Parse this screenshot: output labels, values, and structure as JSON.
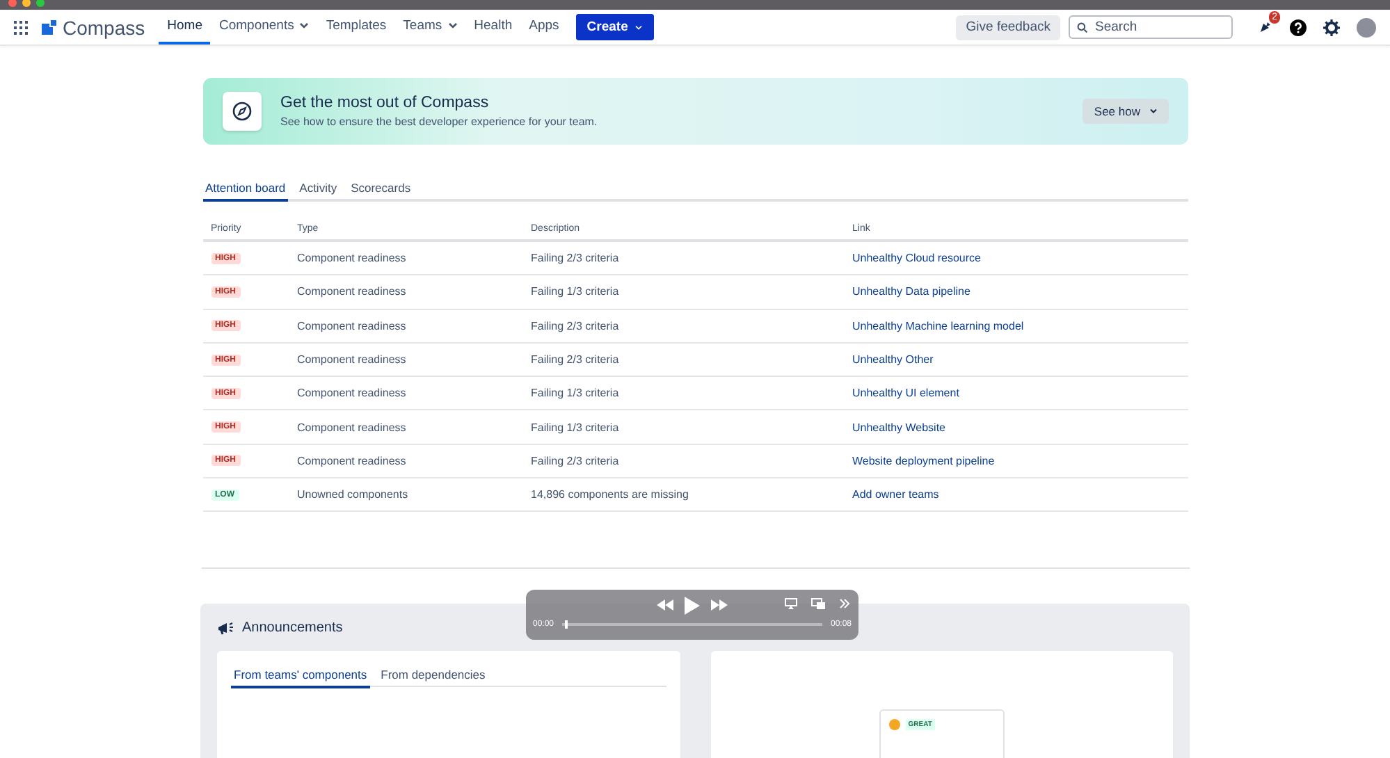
{
  "nav": {
    "logo": "Compass",
    "items": [
      {
        "label": "Home",
        "selected": true,
        "dropdown": false
      },
      {
        "label": "Components",
        "selected": false,
        "dropdown": true
      },
      {
        "label": "Templates",
        "selected": false,
        "dropdown": false
      },
      {
        "label": "Teams",
        "selected": false,
        "dropdown": true
      },
      {
        "label": "Health",
        "selected": false,
        "dropdown": false
      },
      {
        "label": "Apps",
        "selected": false,
        "dropdown": false
      }
    ],
    "create": "Create",
    "feedback": "Give feedback",
    "search": {
      "placeholder": "Search"
    },
    "notification_count": "2"
  },
  "banner": {
    "title": "Get the most out of Compass",
    "subtitle": "See how to ensure the best developer experience for your team.",
    "button": "See how"
  },
  "tabs": [
    {
      "label": "Attention board",
      "selected": true
    },
    {
      "label": "Activity",
      "selected": false
    },
    {
      "label": "Scorecards",
      "selected": false
    }
  ],
  "table": {
    "columns": [
      "Priority",
      "Type",
      "Description",
      "Link"
    ],
    "rows": [
      {
        "priority": "HIGH",
        "kind": "high",
        "type": "Component readiness",
        "description": "Failing 2/3 criteria",
        "link": "Unhealthy Cloud resource"
      },
      {
        "priority": "HIGH",
        "kind": "high",
        "type": "Component readiness",
        "description": "Failing 1/3 criteria",
        "link": "Unhealthy Data pipeline"
      },
      {
        "priority": "HIGH",
        "kind": "high",
        "type": "Component readiness",
        "description": "Failing 2/3 criteria",
        "link": "Unhealthy Machine learning model"
      },
      {
        "priority": "HIGH",
        "kind": "high",
        "type": "Component readiness",
        "description": "Failing 2/3 criteria",
        "link": "Unhealthy Other"
      },
      {
        "priority": "HIGH",
        "kind": "high",
        "type": "Component readiness",
        "description": "Failing 1/3 criteria",
        "link": "Unhealthy UI element"
      },
      {
        "priority": "HIGH",
        "kind": "high",
        "type": "Component readiness",
        "description": "Failing 1/3 criteria",
        "link": "Unhealthy Website"
      },
      {
        "priority": "HIGH",
        "kind": "high",
        "type": "Component readiness",
        "description": "Failing 2/3 criteria",
        "link": "Website deployment pipeline"
      },
      {
        "priority": "LOW",
        "kind": "low",
        "type": "Unowned components",
        "description": "14,896 components are missing",
        "link": "Add owner teams"
      }
    ]
  },
  "announcements": {
    "title": "Announcements",
    "tabs": [
      {
        "label": "From teams' components",
        "selected": true
      },
      {
        "label": "From dependencies",
        "selected": false
      }
    ],
    "preview_badge": "GREAT"
  },
  "video": {
    "time_start": "00:00",
    "time_end": "00:08",
    "level": 0.01
  }
}
